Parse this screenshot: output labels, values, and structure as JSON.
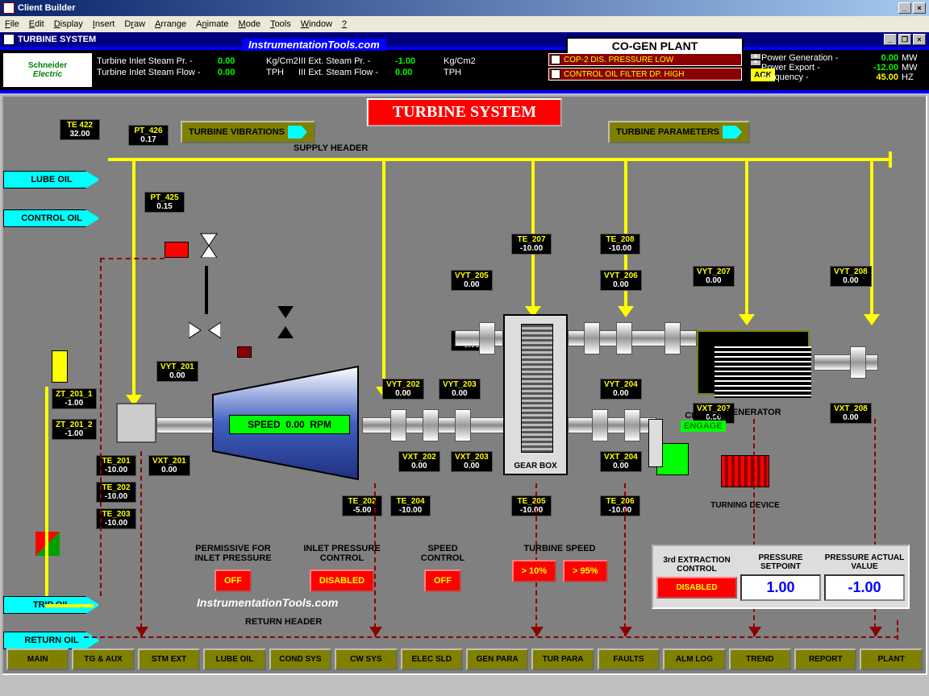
{
  "app": {
    "title": "Client Builder"
  },
  "menu": [
    "File",
    "Edit",
    "Display",
    "Insert",
    "Draw",
    "Arrange",
    "Animate",
    "Mode",
    "Tools",
    "Window",
    "?"
  ],
  "doc": {
    "title": "TURBINE SYSTEM"
  },
  "header": {
    "logo1": "Schneider",
    "logo2": "Electric",
    "link": "InstrumentationTools.com",
    "plant": "CO-GEN PLANT",
    "r1": {
      "lbl": "Turbine Inlet Steam Pr. -",
      "val": "0.00",
      "unit": "Kg/Cm2"
    },
    "r2": {
      "lbl": "Turbine Inlet Steam Flow -",
      "val": "0.00",
      "unit": "TPH"
    },
    "r3": {
      "lbl": "III Ext. Steam Pr. -",
      "val": "-1.00",
      "unit": "Kg/Cm2"
    },
    "r4": {
      "lbl": "III Ext. Steam Flow -",
      "val": "0.00",
      "unit": "TPH"
    },
    "alarm1": "COP-2 DIS. PRESSURE LOW",
    "alarm2": "CONTROL OIL FILTER DP. HIGH",
    "ack": "ACK",
    "p1": {
      "lbl": "Power Generation -",
      "val": "0.00",
      "unit": "MW"
    },
    "p2": {
      "lbl": "Power Export -",
      "val": "-12.00",
      "unit": "MW"
    },
    "p3": {
      "lbl": "Frequency -",
      "val": "45.00",
      "unit": "HZ"
    }
  },
  "canvas": {
    "title": "TURBINE SYSTEM",
    "vibbtn": "TURBINE VIBRATIONS",
    "parabtn": "TURBINE PARAMETERS",
    "supply": "SUPPLY HEADER",
    "return": "RETURN HEADER",
    "lubeoil": "LUBE OIL",
    "controloil": "CONTROL OIL",
    "tripoil": "TRIP OIL",
    "returnoil": "RETURN OIL",
    "speed": {
      "lbl": "SPEED",
      "val": "0.00",
      "unit": "RPM"
    },
    "gearbox": "GEAR BOX",
    "generator": "GENERATOR",
    "clutch": "CLUTCH",
    "engage": "ENGAGE",
    "turndev": "TURNING DEVICE",
    "footerlink": "InstrumentationTools.com",
    "tags": {
      "te422": {
        "n": "TE 422",
        "v": "32.00"
      },
      "pt426": {
        "n": "PT_426",
        "v": "0.17"
      },
      "pt425": {
        "n": "PT_425",
        "v": "0.15"
      },
      "zt2011": {
        "n": "ZT_201_1",
        "v": "-1.00"
      },
      "zt2012": {
        "n": "ZT_201_2",
        "v": "-1.00"
      },
      "te201": {
        "n": "TE_201",
        "v": "-10.00"
      },
      "te202": {
        "n": "TE_202",
        "v": "-10.00"
      },
      "te203": {
        "n": "TE_203",
        "v": "-10.00"
      },
      "vyt201": {
        "n": "VYT_201",
        "v": "0.00"
      },
      "vxt201": {
        "n": "VXT_201",
        "v": "0.00"
      },
      "te2021": {
        "n": "TE_202",
        "v": "-5.00"
      },
      "te204": {
        "n": "TE_204",
        "v": "-10.00"
      },
      "vyt202": {
        "n": "VYT_202",
        "v": "0.00"
      },
      "vyt203": {
        "n": "VYT_203",
        "v": "0.00"
      },
      "vxt202": {
        "n": "VXT_202",
        "v": "0.00"
      },
      "vxt203": {
        "n": "VXT_203",
        "v": "0.00"
      },
      "vxt205": {
        "n": "VXT_205",
        "v": "0.00"
      },
      "vyt205": {
        "n": "VYT_205",
        "v": "0.00"
      },
      "te207": {
        "n": "TE_207",
        "v": "-10.00"
      },
      "te205": {
        "n": "TE_205",
        "v": "-10.00"
      },
      "te208": {
        "n": "TE_208",
        "v": "-10.00"
      },
      "vyt206": {
        "n": "VYT_206",
        "v": "0.00"
      },
      "vyt204": {
        "n": "VYT_204",
        "v": "0.00"
      },
      "vxt204": {
        "n": "VXT_204",
        "v": "0.00"
      },
      "te206": {
        "n": "TE_206",
        "v": "-10.00"
      },
      "vyt207": {
        "n": "VYT_207",
        "v": "0.00"
      },
      "vxt207": {
        "n": "VXT_207",
        "v": "0.00"
      },
      "vyt208": {
        "n": "VYT_208",
        "v": "0.00"
      },
      "vxt208": {
        "n": "VXT_208",
        "v": "0.00"
      }
    },
    "ctrl": {
      "perm": {
        "lbl": "PERMISSIVE FOR\nINLET PRESSURE",
        "btn": "OFF"
      },
      "inlet": {
        "lbl": "INLET PRESSURE\nCONTROL",
        "btn": "DISABLED"
      },
      "speed": {
        "lbl": "SPEED\nCONTROL",
        "btn": "OFF"
      },
      "ts1": {
        "lbl": "TURBINE SPEED",
        "btn": "> 10%"
      },
      "ts2": {
        "btn": "> 95%"
      }
    },
    "extraction": {
      "c1": "3rd EXTRACTION CONTROL",
      "c2": "PRESSURE SETPOINT",
      "c3": "PRESSURE ACTUAL VALUE",
      "dis": "DISABLED",
      "sp": "1.00",
      "av": "-1.00"
    }
  },
  "nav": [
    "MAIN",
    "TG & AUX",
    "STM EXT",
    "LUBE OIL",
    "COND SYS",
    "CW SYS",
    "ELEC SLD",
    "GEN PARA",
    "TUR PARA",
    "FAULTS",
    "ALM LOG",
    "TREND",
    "REPORT",
    "PLANT"
  ]
}
